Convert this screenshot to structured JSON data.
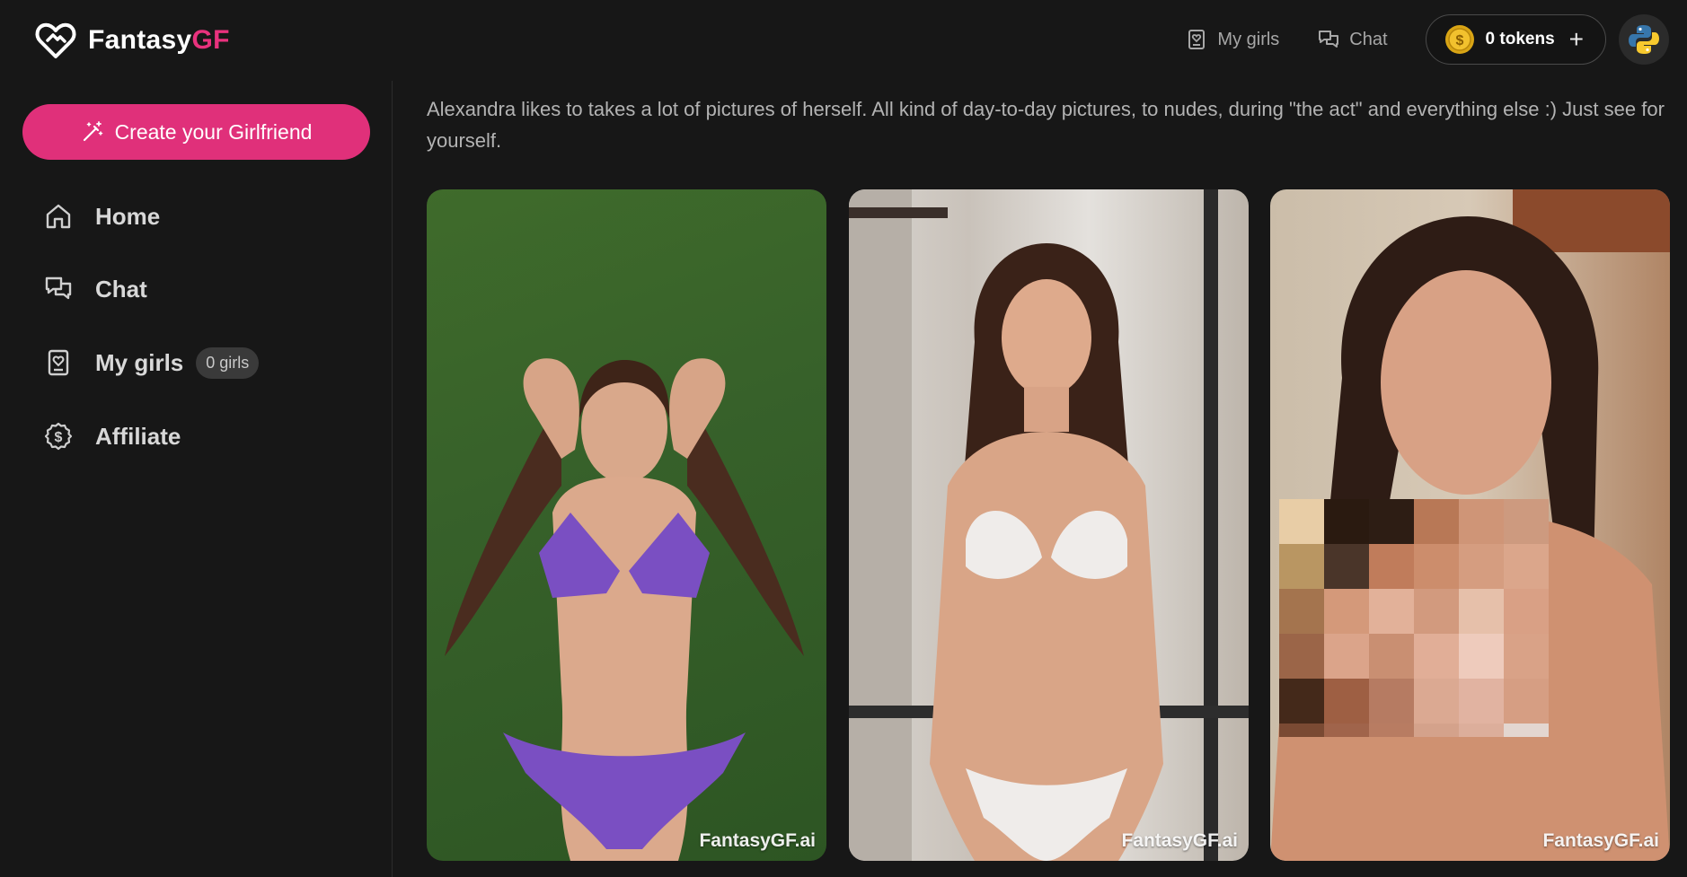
{
  "brand": {
    "name_part1": "Fantasy",
    "name_part2": "GF"
  },
  "topnav": {
    "my_girls": "My girls",
    "chat": "Chat",
    "tokens": "0 tokens",
    "plus": "+"
  },
  "sidebar": {
    "create_button": "Create your Girlfriend",
    "items": [
      {
        "label": "Home",
        "icon": "home-icon"
      },
      {
        "label": "Chat",
        "icon": "chat-icon"
      },
      {
        "label": "My girls",
        "icon": "portrait-icon",
        "badge": "0 girls"
      },
      {
        "label": "Affiliate",
        "icon": "dollar-icon"
      }
    ]
  },
  "main": {
    "description": "Alexandra likes to takes a lot of pictures of herself. All kind of day-to-day pictures, to nudes, during \"the act\" and everything else :) Just see for yourself.",
    "gallery": [
      {
        "watermark": "FantasyGF.ai"
      },
      {
        "watermark": "FantasyGF.ai"
      },
      {
        "watermark": "FantasyGF.ai"
      }
    ]
  },
  "colors": {
    "accent": "#e0307a",
    "background": "#171717"
  }
}
